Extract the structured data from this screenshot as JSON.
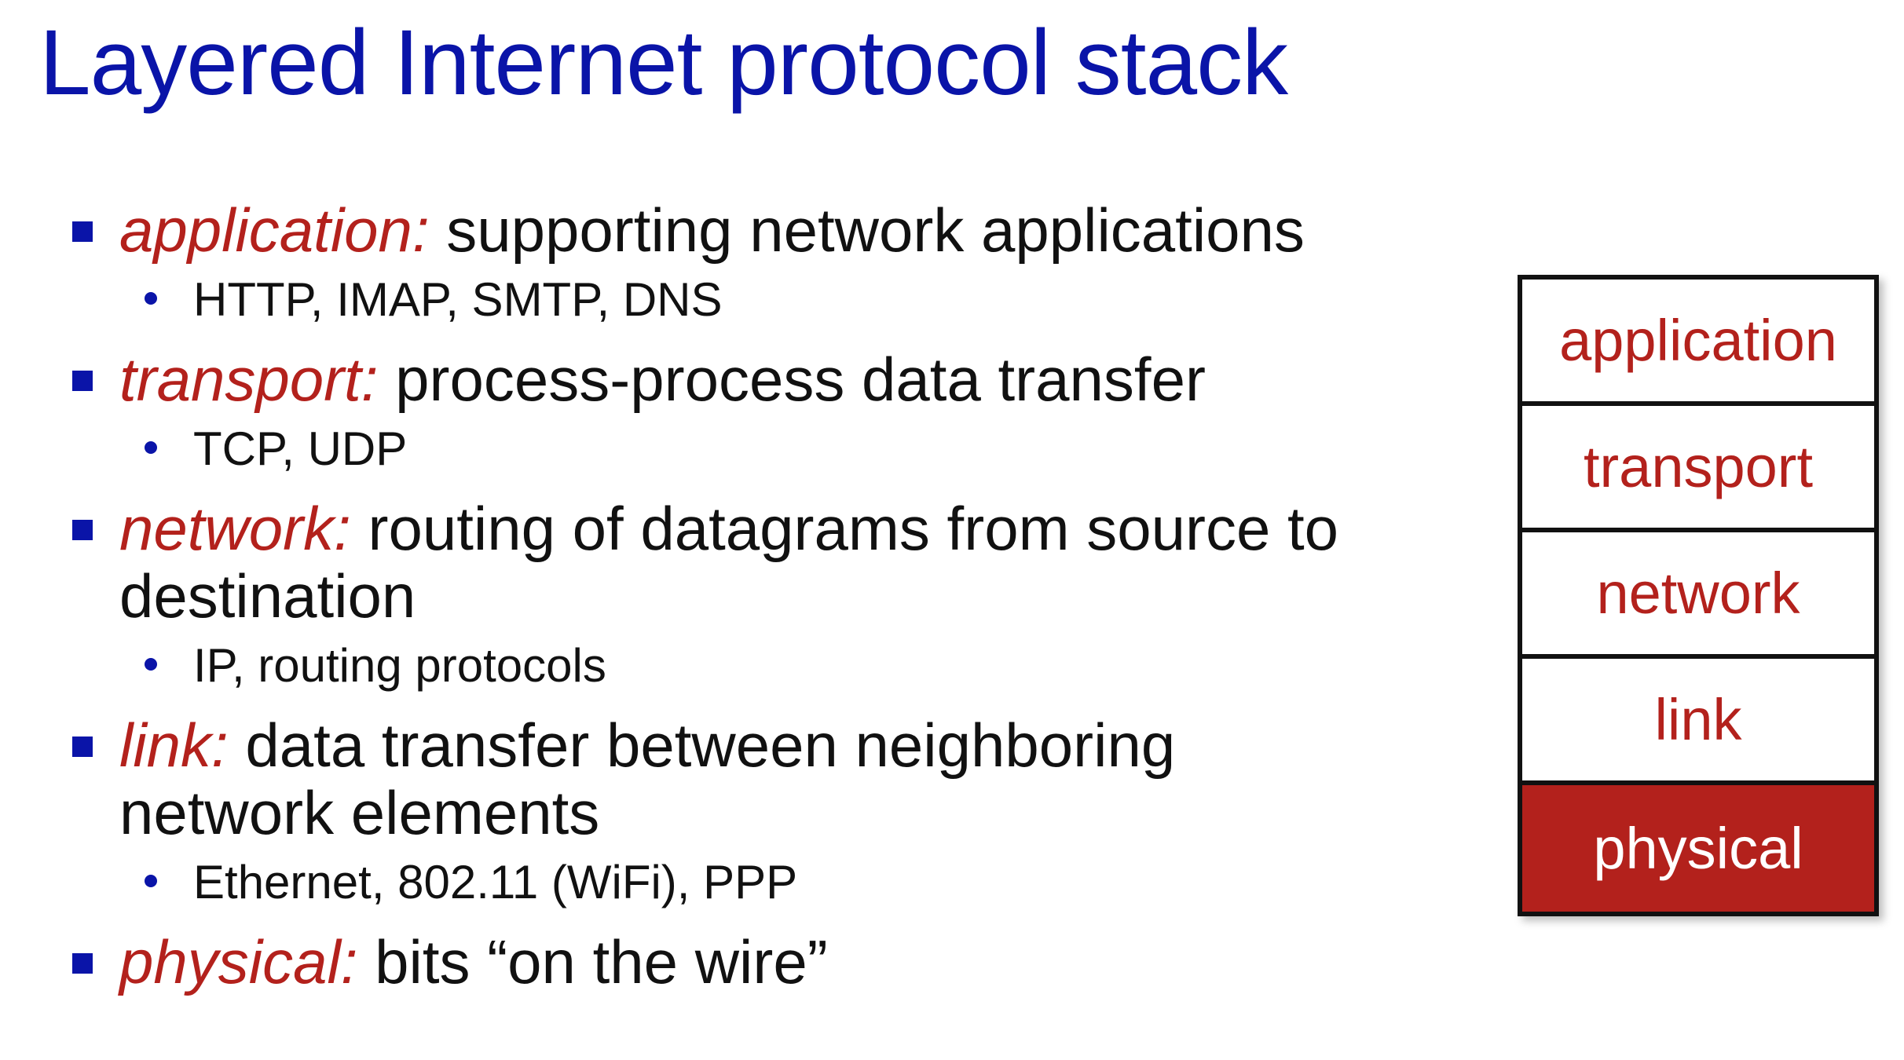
{
  "slide": {
    "title": "Layered Internet protocol stack",
    "accent_color": "#0a14a8",
    "term_color": "#b3211c"
  },
  "bullets": [
    {
      "term": "application:",
      "text": " supporting network applications",
      "sub": "HTTP, IMAP, SMTP, DNS"
    },
    {
      "term": "transport:",
      "text": " process-process data transfer",
      "sub": "TCP, UDP"
    },
    {
      "term": "network:",
      "text": " routing of datagrams from source to destination",
      "sub": "IP, routing protocols"
    },
    {
      "term": "link:",
      "text": " data transfer between neighboring network elements",
      "sub": "Ethernet, 802.11 (WiFi), PPP"
    },
    {
      "term": "physical:",
      "text": " bits “on the wire”"
    }
  ],
  "stack": {
    "layers": [
      "application",
      "transport",
      "network",
      "link",
      "physical"
    ],
    "highlighted": "physical"
  }
}
